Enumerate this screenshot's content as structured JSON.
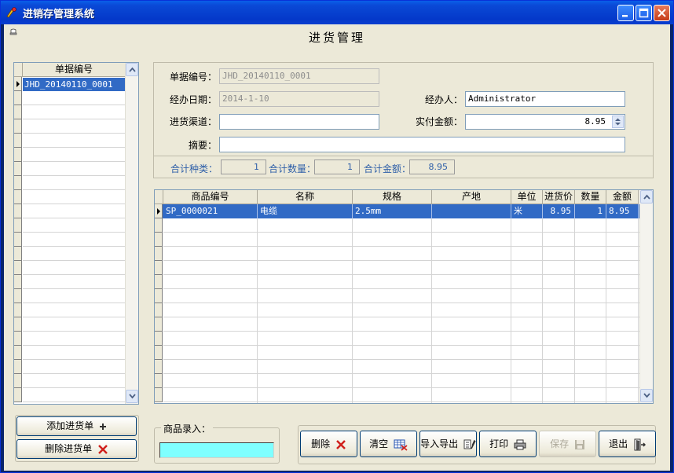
{
  "window": {
    "title": "进销存管理系统"
  },
  "page": {
    "title": "进货管理"
  },
  "left_list": {
    "header": "单据编号",
    "items": [
      "JHD_20140110_0001"
    ]
  },
  "form": {
    "doc_no_label": "单据编号：",
    "doc_no_value": "JHD_20140110_0001",
    "date_label": "经办日期：",
    "date_value": "2014-1-10",
    "handler_label": "经办人：",
    "handler_value": "Administrator",
    "channel_label": "进货渠道：",
    "channel_value": "",
    "paid_label": "实付金额：",
    "paid_value": "8.95",
    "summary_label": "摘要：",
    "summary_value": ""
  },
  "totals": {
    "kinds_label": "合计种类：",
    "kinds_value": "1",
    "qty_label": "合计数量：",
    "qty_value": "1",
    "amount_label": "合计金额：",
    "amount_value": "8.95"
  },
  "goods_table": {
    "columns": [
      "商品编号",
      "名称",
      "规格",
      "产地",
      "单位",
      "进货价",
      "数量",
      "金额"
    ],
    "rows": [
      [
        "SP_0000021",
        "电缆",
        "2.5mm",
        "",
        "米",
        "8.95",
        "1",
        "8.95"
      ]
    ]
  },
  "entry": {
    "label": "商品录入：",
    "value": ""
  },
  "buttons": {
    "add": "添加进货单",
    "remove": "删除进货单",
    "delete": "删除",
    "clear": "清空",
    "import_export": "导入导出",
    "print": "打印",
    "save": "保存",
    "exit": "退出"
  },
  "colors": {
    "titlebar": "#0438c9",
    "selection": "#316ac5",
    "entry_bg": "#7fffff",
    "summary_text": "#2e5fa8",
    "delete_icon": "#d0201c"
  }
}
